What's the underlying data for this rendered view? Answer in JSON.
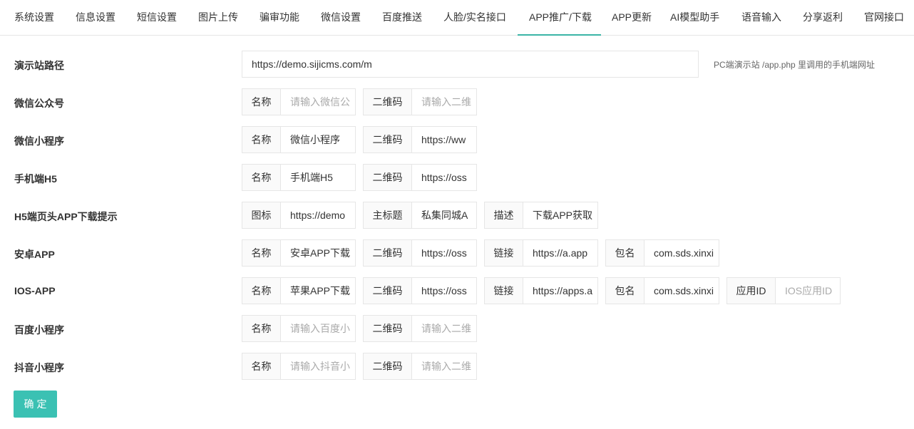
{
  "tabs": [
    {
      "label": "系统设置"
    },
    {
      "label": "信息设置"
    },
    {
      "label": "短信设置"
    },
    {
      "label": "图片上传"
    },
    {
      "label": "骗审功能"
    },
    {
      "label": "微信设置"
    },
    {
      "label": "百度推送"
    },
    {
      "label": "人脸/实名接口"
    },
    {
      "label": "APP推广/下载"
    },
    {
      "label": "APP更新"
    },
    {
      "label": "AI模型助手"
    },
    {
      "label": "语音输入"
    },
    {
      "label": "分享返利"
    },
    {
      "label": "官网接口"
    }
  ],
  "active_tab": "APP推广/下载",
  "accent_color": "#3bc1b3",
  "demo": {
    "label": "演示站路径",
    "value": "https://demo.sijicms.com/m",
    "hint": "PC端演示站 /app.php 里调用的手机端网址"
  },
  "rows": [
    {
      "label": "微信公众号",
      "fields": [
        {
          "addon": "名称",
          "value": "",
          "placeholder": "请输入微信公"
        },
        {
          "addon": "二维码",
          "value": "",
          "placeholder": "请输入二维"
        }
      ]
    },
    {
      "label": "微信小程序",
      "fields": [
        {
          "addon": "名称",
          "value": "微信小程序",
          "placeholder": ""
        },
        {
          "addon": "二维码",
          "value": "https://ww",
          "placeholder": ""
        }
      ]
    },
    {
      "label": "手机端H5",
      "fields": [
        {
          "addon": "名称",
          "value": "手机端H5",
          "placeholder": ""
        },
        {
          "addon": "二维码",
          "value": "https://oss",
          "placeholder": ""
        }
      ]
    },
    {
      "label": "H5端页头APP下载提示",
      "fields": [
        {
          "addon": "图标",
          "value": "https://demo",
          "placeholder": ""
        },
        {
          "addon": "主标题",
          "value": "私集同城A",
          "placeholder": ""
        },
        {
          "addon": "描述",
          "value": "下载APP获取",
          "placeholder": ""
        }
      ]
    },
    {
      "label": "安卓APP",
      "fields": [
        {
          "addon": "名称",
          "value": "安卓APP下载",
          "placeholder": ""
        },
        {
          "addon": "二维码",
          "value": "https://oss",
          "placeholder": ""
        },
        {
          "addon": "链接",
          "value": "https://a.app",
          "placeholder": ""
        },
        {
          "addon": "包名",
          "value": "com.sds.xinxi",
          "placeholder": ""
        }
      ]
    },
    {
      "label": "IOS-APP",
      "fields": [
        {
          "addon": "名称",
          "value": "苹果APP下载",
          "placeholder": ""
        },
        {
          "addon": "二维码",
          "value": "https://oss",
          "placeholder": ""
        },
        {
          "addon": "链接",
          "value": "https://apps.a",
          "placeholder": ""
        },
        {
          "addon": "包名",
          "value": "com.sds.xinxi",
          "placeholder": ""
        },
        {
          "addon": "应用ID",
          "value": "",
          "placeholder": "IOS应用ID"
        }
      ]
    },
    {
      "label": "百度小程序",
      "fields": [
        {
          "addon": "名称",
          "value": "",
          "placeholder": "请输入百度小"
        },
        {
          "addon": "二维码",
          "value": "",
          "placeholder": "请输入二维"
        }
      ]
    },
    {
      "label": "抖音小程序",
      "fields": [
        {
          "addon": "名称",
          "value": "",
          "placeholder": "请输入抖音小"
        },
        {
          "addon": "二维码",
          "value": "",
          "placeholder": "请输入二维"
        }
      ]
    }
  ],
  "submit_label": "确定"
}
